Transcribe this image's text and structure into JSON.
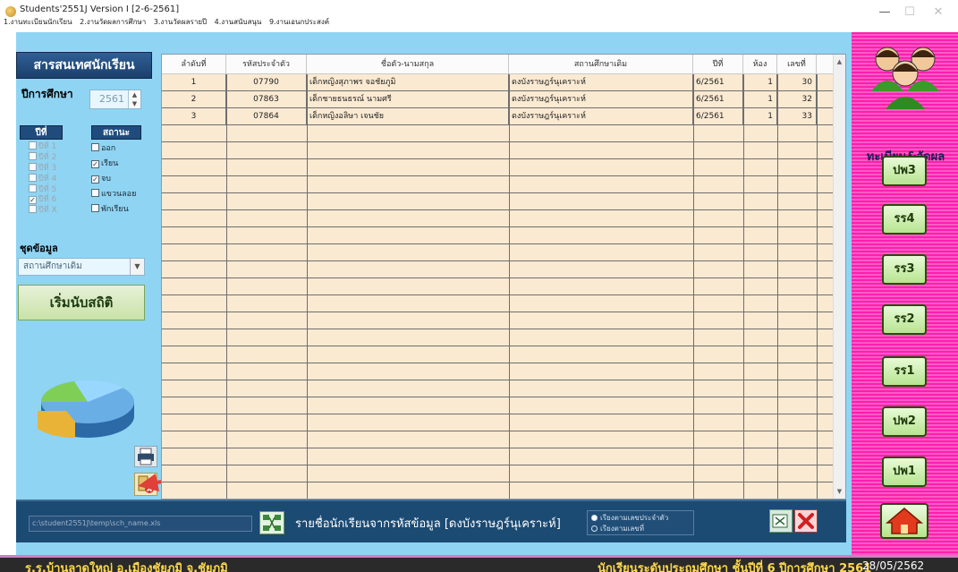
{
  "window": {
    "title": "Students'2551J Version I [2-6-2561]",
    "menu": [
      "1.งานทะเบียนนักเรียน",
      "2.งานวัดผลการศึกษา",
      "3.งานวัดผลรายปี",
      "4.งานสนับสนุน",
      "9.งานเอนกประสงค์"
    ],
    "controls": {
      "minimize": "—",
      "maximize": "☐",
      "close": "✕"
    }
  },
  "left": {
    "header": "สารสนเทศนักเรียน",
    "year_label": "ปีการศึกษา",
    "year_value": "2561",
    "col_year": "ปีที่",
    "col_status": "สถานะ",
    "years": [
      {
        "label": "ปีที่ 1",
        "checked": false
      },
      {
        "label": "ปีที่ 2",
        "checked": false
      },
      {
        "label": "ปีที่ 3",
        "checked": false
      },
      {
        "label": "ปีที่ 4",
        "checked": false
      },
      {
        "label": "ปีที่ 5",
        "checked": false
      },
      {
        "label": "ปีที่ 6",
        "checked": true
      },
      {
        "label": "ปีที่ X",
        "checked": false
      }
    ],
    "statuses": [
      {
        "label": "ออก",
        "checked": false
      },
      {
        "label": "เรียน",
        "checked": true
      },
      {
        "label": "จบ",
        "checked": true
      },
      {
        "label": "แขวนลอย",
        "checked": false
      },
      {
        "label": "พักเรียน",
        "checked": false
      }
    ],
    "dataset_label": "ชุดข้อมูล",
    "dataset_value": "สถานศึกษาเดิม",
    "start_button": "เริ่มนับสถิติ"
  },
  "table": {
    "headers": [
      "ลำดับที่",
      "รหัสประจำตัว",
      "ชื่อตัว-นามสกุล",
      "สถานศึกษาเดิม",
      "ปีที่",
      "ห้อง",
      "เลขที่"
    ],
    "rows": [
      [
        "1",
        "07790",
        "เด็กหญิงสุภาพร    จอชัยภูมิ",
        "ดงบังราษฎร์นุเคราะห์",
        "6/2561",
        "1",
        "30"
      ],
      [
        "2",
        "07863",
        "เด็กชายธนธรณ์    นามศรี",
        "ดงบังราษฎร์นุเคราะห์",
        "6/2561",
        "1",
        "32"
      ],
      [
        "3",
        "07864",
        "เด็กหญิงอลิษา    เจนชัย",
        "ดงบังราษฎร์นุเคราะห์",
        "6/2561",
        "1",
        "33"
      ]
    ]
  },
  "bottom": {
    "path": "c:\\student2551J\\temp\\sch_name.xls",
    "status": "รายชื่อนักเรียนจากรหัสข้อมูล [ดงบังราษฎร์นุเคราะห์]",
    "sort_options": [
      "เรียงตามเลขประจำตัว",
      "เรียงตามเลขที่"
    ]
  },
  "right": {
    "caption": "ทะเบียน&วัดผล",
    "buttons": [
      "ปพ3",
      "รร4",
      "รร3",
      "รร2",
      "รร1",
      "ปพ2",
      "ปพ1"
    ]
  },
  "footer": {
    "school": "ร.ร.บ้านลาดใหญ่  อ.เมืองชัยภูมิ  จ.ชัยภูมิ",
    "level": "นักเรียนระดับประถมศึกษา  ชั้นปีที่ 6  ปีการศึกษา 2561",
    "date": "28/05/2562"
  },
  "colors": {
    "panel_bg": "#8fd4f3",
    "header_blue": "#1c3f6c",
    "table_row": "#fbead2",
    "sidebar_pink": "#ff1fae",
    "footer_text": "#ffd84a"
  }
}
